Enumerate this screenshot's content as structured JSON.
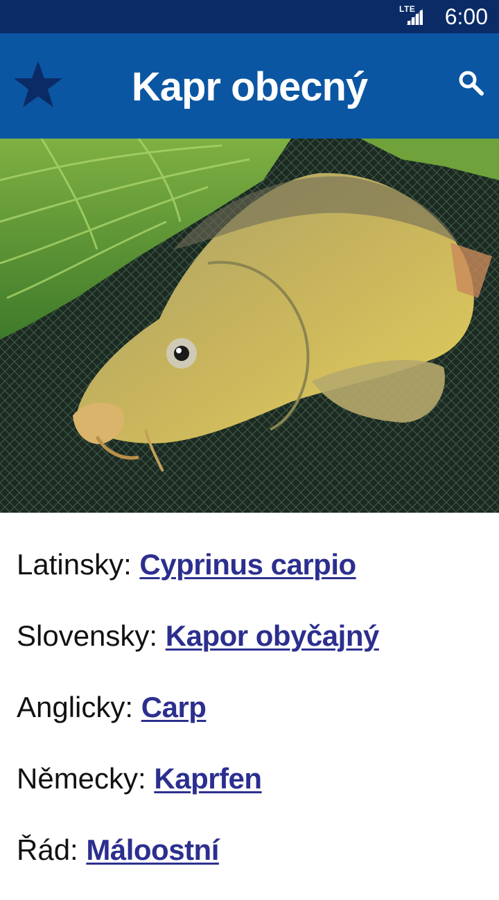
{
  "status_bar": {
    "network": "LTE",
    "time": "6:00"
  },
  "app_bar": {
    "title": "Kapr obecný",
    "favorite_icon": "star-icon",
    "search_icon": "search-icon"
  },
  "photo": {
    "subject_icon": "fish-photo"
  },
  "info": [
    {
      "label": "Latinsky:",
      "value": "Cyprinus carpio"
    },
    {
      "label": "Slovensky:",
      "value": "Kapor obyčajný"
    },
    {
      "label": "Anglicky:",
      "value": "Carp"
    },
    {
      "label": "Německy:",
      "value": "Kaprfen"
    },
    {
      "label": "Řád:",
      "value": "Máloostní"
    }
  ],
  "colors": {
    "status_bar": "#0b2b66",
    "app_bar": "#0b56a2",
    "link": "#2c2f8e"
  }
}
